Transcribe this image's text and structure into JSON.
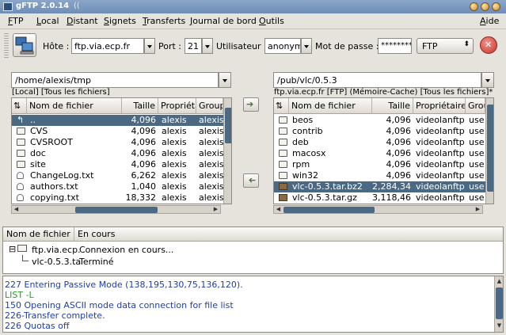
{
  "window": {
    "title": "gFTP 2.0.14"
  },
  "menu": [
    "FTP",
    "Local",
    "Distant",
    "Signets",
    "Transferts",
    "Journal de bord",
    "Outils",
    "Aide"
  ],
  "toolbar": {
    "host_label": "Hôte :",
    "host_value": "ftp.via.ecp.fr",
    "port_label": "Port :",
    "port_value": "21",
    "user_label": "Utilisateur :",
    "user_value": "anonymous",
    "pass_label": "Mot de passe :",
    "pass_value": "*********",
    "protocol": "FTP"
  },
  "local": {
    "path": "/home/alexis/tmp",
    "status": "[Local] [Tous les fichiers]",
    "columns": [
      "Nom de fichier",
      "Taille",
      "Propriéta",
      "Groupe"
    ],
    "rows": [
      {
        "icon": "parent",
        "name": "..",
        "size": "4,096",
        "owner": "alexis",
        "group": "alexis",
        "selected": true
      },
      {
        "icon": "folder",
        "name": "CVS",
        "size": "4,096",
        "owner": "alexis",
        "group": "alexis"
      },
      {
        "icon": "folder",
        "name": "CVSROOT",
        "size": "4,096",
        "owner": "alexis",
        "group": "alexis"
      },
      {
        "icon": "folder",
        "name": "doc",
        "size": "4,096",
        "owner": "alexis",
        "group": "alexis"
      },
      {
        "icon": "folder",
        "name": "site",
        "size": "4,096",
        "owner": "alexis",
        "group": "alexis"
      },
      {
        "icon": "file",
        "name": "ChangeLog.txt",
        "size": "6,262",
        "owner": "alexis",
        "group": "alexis"
      },
      {
        "icon": "file",
        "name": "authors.txt",
        "size": "1,040",
        "owner": "alexis",
        "group": "alexis"
      },
      {
        "icon": "file",
        "name": "copying.txt",
        "size": "18,332",
        "owner": "alexis",
        "group": "alexis"
      }
    ]
  },
  "remote": {
    "path": "/pub/vlc/0.5.3",
    "status": "ftp.via.ecp.fr [FTP] (Mémoire-Cache) [Tous les fichiers]*",
    "columns": [
      "Nom de fichier",
      "Taille",
      "Propriétaire",
      "Grou"
    ],
    "rows": [
      {
        "icon": "folder",
        "name": "beos",
        "size": "4,096",
        "owner": "videolanftp",
        "group": "use"
      },
      {
        "icon": "folder",
        "name": "contrib",
        "size": "4,096",
        "owner": "videolanftp",
        "group": "use"
      },
      {
        "icon": "folder",
        "name": "deb",
        "size": "4,096",
        "owner": "videolanftp",
        "group": "use"
      },
      {
        "icon": "folder",
        "name": "macosx",
        "size": "4,096",
        "owner": "videolanftp",
        "group": "use"
      },
      {
        "icon": "folder",
        "name": "rpm",
        "size": "4,096",
        "owner": "videolanftp",
        "group": "use"
      },
      {
        "icon": "folder",
        "name": "win32",
        "size": "4,096",
        "owner": "videolanftp",
        "group": "use"
      },
      {
        "icon": "package",
        "name": "vlc-0.5.3.tar.bz2",
        "size": "2,284,349",
        "owner": "videolanftp",
        "group": "use",
        "selected": true
      },
      {
        "icon": "package",
        "name": "vlc-0.5.3.tar.gz",
        "size": "3,118,465",
        "owner": "videolanftp",
        "group": "use"
      }
    ]
  },
  "transfers": {
    "columns": [
      "Nom de fichier",
      "En cours"
    ],
    "rows": [
      {
        "name": "ftp.via.ecp.",
        "status": "Connexion en cours..."
      },
      {
        "name": "vlc-0.5.3.ta",
        "status": "Terminé"
      }
    ]
  },
  "log": [
    {
      "text": "227 Entering Passive Mode (138,195,130,75,136,120).",
      "color": "#1f3fa8"
    },
    {
      "text": "LIST -L",
      "color": "#2a9a2a"
    },
    {
      "text": "150 Opening ASCII mode data connection for file list",
      "color": "#1f3fa8"
    },
    {
      "text": "226-Transfer complete.",
      "color": "#1f3fa8"
    },
    {
      "text": "226 Quotas off",
      "color": "#1f3fa8"
    }
  ],
  "colors": {
    "selection": "#4b6983",
    "titlebar": "#7594bd"
  }
}
